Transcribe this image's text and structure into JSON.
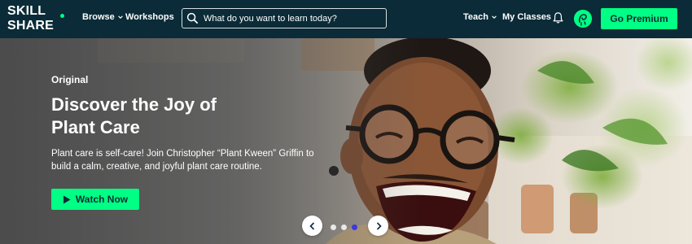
{
  "brand": {
    "logo_line1": "SKILL",
    "logo_line2": "SHARE",
    "accent_color": "#00ff84",
    "nav_bg_color": "#0a2b37"
  },
  "nav": {
    "browse_label": "Browse",
    "workshops_label": "Workshops",
    "search_placeholder": "What do you want to learn today?",
    "teach_label": "Teach",
    "my_classes_label": "My Classes",
    "premium_label": "Go Premium",
    "icons": [
      "search-icon",
      "chevron-down-icon",
      "bell-icon",
      "avatar"
    ]
  },
  "hero": {
    "eyebrow": "Original",
    "headline": "Discover the Joy of Plant Care",
    "description": "Plant care is self-care! Join Christopher “Plant Kween” Griffin to build a calm, creative, and joyful plant care routine.",
    "cta_label": "Watch Now",
    "carousel": {
      "slides": 3,
      "active_index": 2
    }
  }
}
